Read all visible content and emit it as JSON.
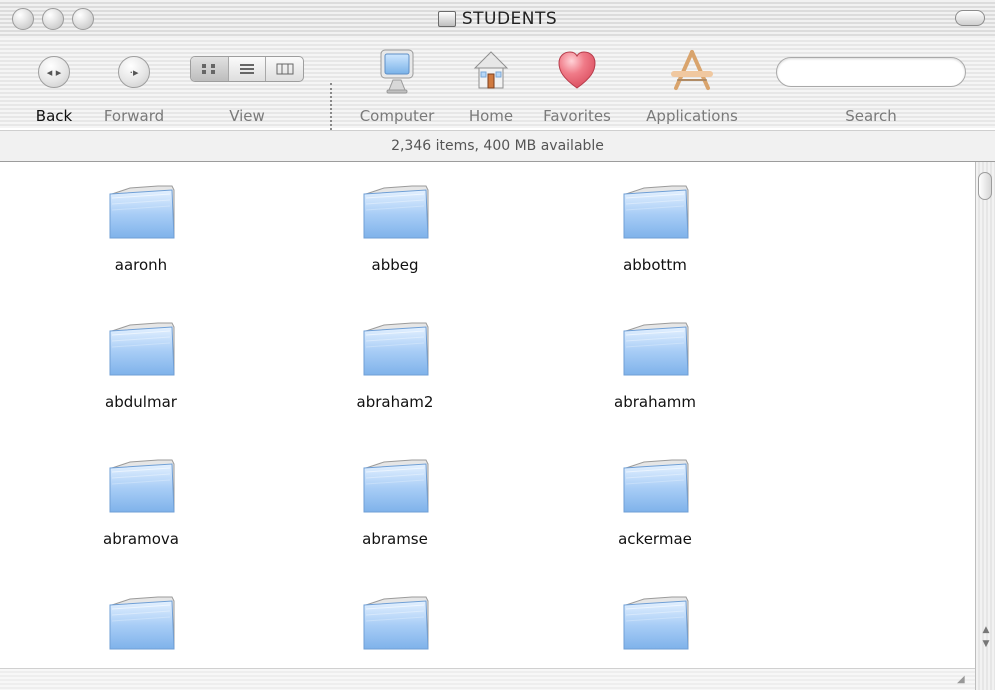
{
  "window": {
    "title": "STUDENTS"
  },
  "toolbar": {
    "back_label": "Back",
    "forward_label": "Forward",
    "view_label": "View",
    "computer_label": "Computer",
    "home_label": "Home",
    "favorites_label": "Favorites",
    "applications_label": "Applications",
    "search_label": "Search",
    "search_value": ""
  },
  "status": {
    "text": "2,346 items, 400 MB available"
  },
  "files": [
    {
      "name": "aaronh"
    },
    {
      "name": "abbeg"
    },
    {
      "name": "abbottm"
    },
    {
      "name": "abdulmar"
    },
    {
      "name": "abraham2"
    },
    {
      "name": "abrahamm"
    },
    {
      "name": "abramova"
    },
    {
      "name": "abramse"
    },
    {
      "name": "ackermae"
    },
    {
      "name": ""
    },
    {
      "name": ""
    },
    {
      "name": ""
    }
  ],
  "icons": {
    "title": "drive-icon",
    "back": "back-arrow-icon",
    "forward": "forward-arrow-icon",
    "view_icon": "icon-view-icon",
    "view_list": "list-view-icon",
    "view_column": "column-view-icon",
    "computer": "computer-icon",
    "home": "home-icon",
    "favorites": "heart-icon",
    "applications": "applications-icon"
  },
  "colors": {
    "folder_blue": "#9cc3f0",
    "heart": "#e85f6e"
  }
}
